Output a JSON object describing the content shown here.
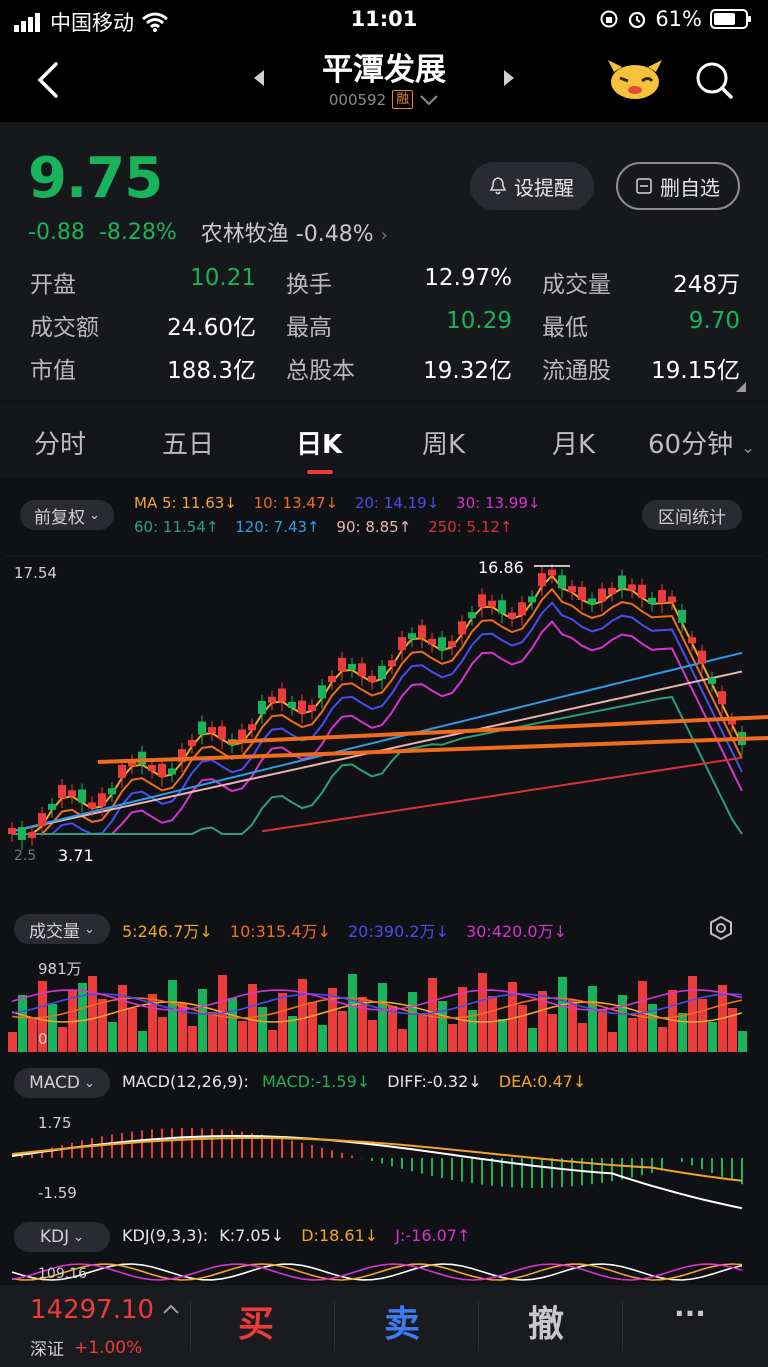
{
  "status_bar": {
    "carrier": "中国移动",
    "time": "11:01",
    "battery": "61%"
  },
  "header": {
    "title": "平潭发展",
    "code": "000592",
    "margin_badge": "融"
  },
  "quote": {
    "price": "9.75",
    "change": "-0.88",
    "change_pct": "-8.28%",
    "sector_name": "农林牧渔",
    "sector_change": "-0.48%",
    "alert_button": "设提醒",
    "remove_button": "删自选",
    "stats": [
      [
        {
          "label": "开盘",
          "value": "10.21",
          "color": "green"
        },
        {
          "label": "换手",
          "value": "12.97%",
          "color": "white"
        },
        {
          "label": "成交量",
          "value": "248万",
          "color": "white"
        }
      ],
      [
        {
          "label": "成交额",
          "value": "24.60亿",
          "color": "white"
        },
        {
          "label": "最高",
          "value": "10.29",
          "color": "green"
        },
        {
          "label": "最低",
          "value": "9.70",
          "color": "green"
        }
      ],
      [
        {
          "label": "市值",
          "value": "188.3亿",
          "color": "white"
        },
        {
          "label": "总股本",
          "value": "19.32亿",
          "color": "white"
        },
        {
          "label": "流通股",
          "value": "19.15亿",
          "color": "white"
        }
      ]
    ]
  },
  "tabs": [
    "分时",
    "五日",
    "日K",
    "周K",
    "月K",
    "60分钟"
  ],
  "kline": {
    "adjust_label": "前复权",
    "range_stats_button": "区间统计",
    "ma_row1": [
      {
        "text": "MA 5: 11.63↓",
        "color": "#f0a52a"
      },
      {
        "text": "10: 13.47↓",
        "color": "#ef6c1f"
      },
      {
        "text": "20: 14.19↓",
        "color": "#4a4cf0"
      },
      {
        "text": "30: 13.99↓",
        "color": "#d633d2"
      }
    ],
    "ma_row2": [
      {
        "text": "60: 11.54↑",
        "color": "#2aa07a"
      },
      {
        "text": "120: 7.43↑",
        "color": "#2e9be6"
      },
      {
        "text": "90: 8.85↑",
        "color": "#e8b4b0"
      },
      {
        "text": "250: 5.12↑",
        "color": "#d7313b"
      }
    ],
    "y_high_label": "17.54",
    "peak_label": "16.86",
    "low_label": "3.71",
    "low_label_faint": "2.5"
  },
  "volume": {
    "label": "成交量",
    "ma": [
      {
        "text": "5:246.7万↓",
        "color": "#f0a52a"
      },
      {
        "text": "10:315.4万↓",
        "color": "#ef6c1f"
      },
      {
        "text": "20:390.2万↓",
        "color": "#4a4cf0"
      },
      {
        "text": "30:420.0万↓",
        "color": "#d633d2"
      }
    ],
    "max_label": "981万",
    "min_label": "0"
  },
  "macd": {
    "label": "MACD",
    "params": "MACD(12,26,9):",
    "macd_value": "MACD:-1.59↓",
    "diff_value": "DIFF:-0.32↓",
    "dea_value": "DEA:0.47↓",
    "y_top": "1.75",
    "y_bottom": "-1.59"
  },
  "kdj": {
    "label": "KDJ",
    "params": "KDJ(9,3,3):",
    "k_value": "K:7.05↓",
    "d_value": "D:18.61↓",
    "j_value": "J:-16.07↑",
    "y_top": "109.16"
  },
  "bottom_bar": {
    "index_value": "14297.10",
    "index_name": "深证",
    "index_change": "+1.00%",
    "buy": "买",
    "sell": "卖",
    "cancel": "撤",
    "more": "···"
  }
}
